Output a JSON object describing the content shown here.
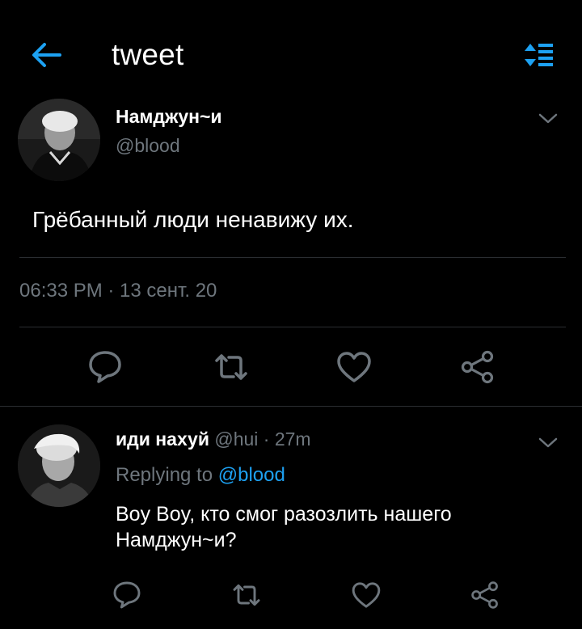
{
  "topbar": {
    "title": "tweet",
    "back_icon": "arrow-left-icon",
    "sort_icon": "sort-list-icon",
    "accent_color": "#1da1f2"
  },
  "main_tweet": {
    "name": "Намджун~и",
    "handle": "@blood",
    "text": "Грёбанный люди ненавижу их.",
    "meta": "06:33 PM · 13 сент. 20",
    "avatar_icon": "profile-photo",
    "menu_icon": "chevron-down-icon",
    "actions": [
      "reply-icon",
      "retweet-icon",
      "like-icon",
      "share-icon"
    ]
  },
  "reply_tweet": {
    "name": "иди нахуй",
    "sub": " @hui · 27m",
    "replying_prefix": "Replying to ",
    "replying_to": "@blood",
    "text_line1": "Boy Boy, кто смог разозлить нашего",
    "text_line2": "Намджун~и?",
    "avatar_icon": "profile-photo",
    "menu_icon": "chevron-down-icon",
    "actions": [
      "reply-icon",
      "retweet-icon",
      "like-icon",
      "share-icon"
    ]
  },
  "colors": {
    "background": "#000000",
    "text_primary": "#ffffff",
    "text_secondary": "#6e767d",
    "divider": "#2a2d31",
    "accent": "#1da1f2"
  }
}
